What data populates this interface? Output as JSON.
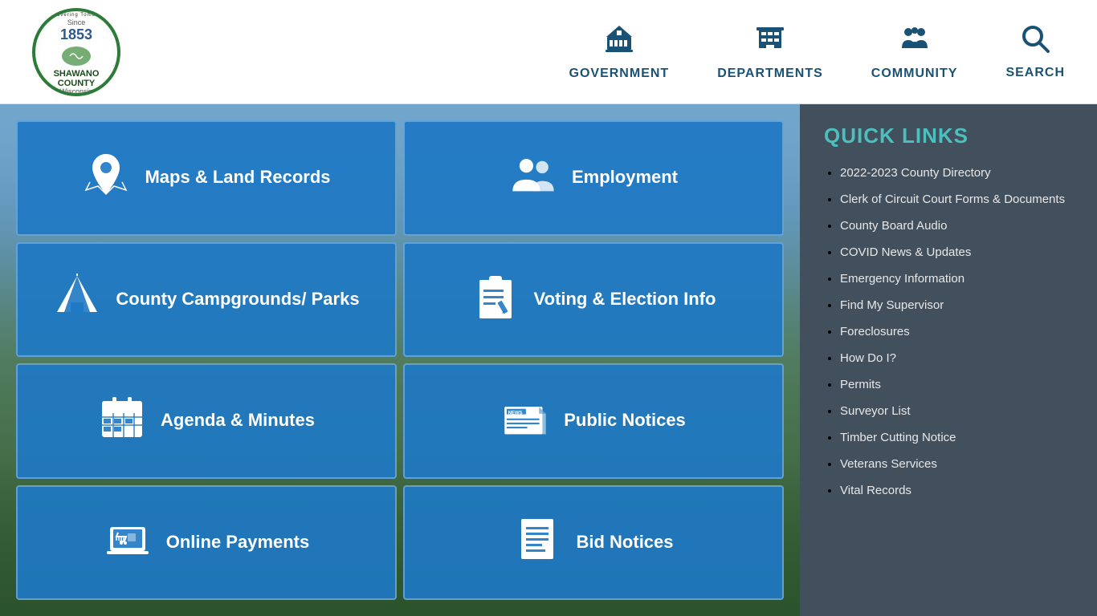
{
  "header": {
    "logo": {
      "arc_top": "Honoring Tradition · Discovering Tomorrow",
      "since": "Since",
      "year": "1853",
      "name": "SHAWANO COUNTY",
      "state": "Wisconsin"
    },
    "nav": [
      {
        "id": "government",
        "label": "GOVERNMENT",
        "icon": "government"
      },
      {
        "id": "departments",
        "label": "DEPARTMENTS",
        "icon": "departments"
      },
      {
        "id": "community",
        "label": "COMMUNITY",
        "icon": "community"
      },
      {
        "id": "search",
        "label": "SEARCH",
        "icon": "search"
      }
    ]
  },
  "tiles": [
    {
      "id": "maps-land-records",
      "label": "Maps & Land Records",
      "icon": "map-pin"
    },
    {
      "id": "employment",
      "label": "Employment",
      "icon": "people"
    },
    {
      "id": "county-campgrounds",
      "label": "County Campgrounds/ Parks",
      "icon": "tent"
    },
    {
      "id": "voting-election",
      "label": "Voting & Election Info",
      "icon": "clipboard"
    },
    {
      "id": "agenda-minutes",
      "label": "Agenda & Minutes",
      "icon": "calendar"
    },
    {
      "id": "public-notices",
      "label": "Public Notices",
      "icon": "newspaper"
    },
    {
      "id": "online-payments",
      "label": "Online Payments",
      "icon": "cart"
    },
    {
      "id": "bid-notices",
      "label": "Bid Notices",
      "icon": "document"
    }
  ],
  "sidebar": {
    "title": "QUICK LINKS",
    "links": [
      {
        "id": "county-directory",
        "label": "2022-2023 County Directory"
      },
      {
        "id": "clerk-forms",
        "label": "Clerk of Circuit Court Forms & Documents"
      },
      {
        "id": "county-board-audio",
        "label": "County Board Audio"
      },
      {
        "id": "covid-news",
        "label": "COVID News & Updates"
      },
      {
        "id": "emergency-info",
        "label": "Emergency Information"
      },
      {
        "id": "find-supervisor",
        "label": "Find My Supervisor"
      },
      {
        "id": "foreclosures",
        "label": "Foreclosures"
      },
      {
        "id": "how-do-i",
        "label": "How Do I?"
      },
      {
        "id": "permits",
        "label": "Permits"
      },
      {
        "id": "surveyor-list",
        "label": "Surveyor List"
      },
      {
        "id": "timber-cutting",
        "label": "Timber Cutting Notice"
      },
      {
        "id": "veterans-services",
        "label": "Veterans Services"
      },
      {
        "id": "vital-records",
        "label": "Vital Records"
      }
    ]
  }
}
